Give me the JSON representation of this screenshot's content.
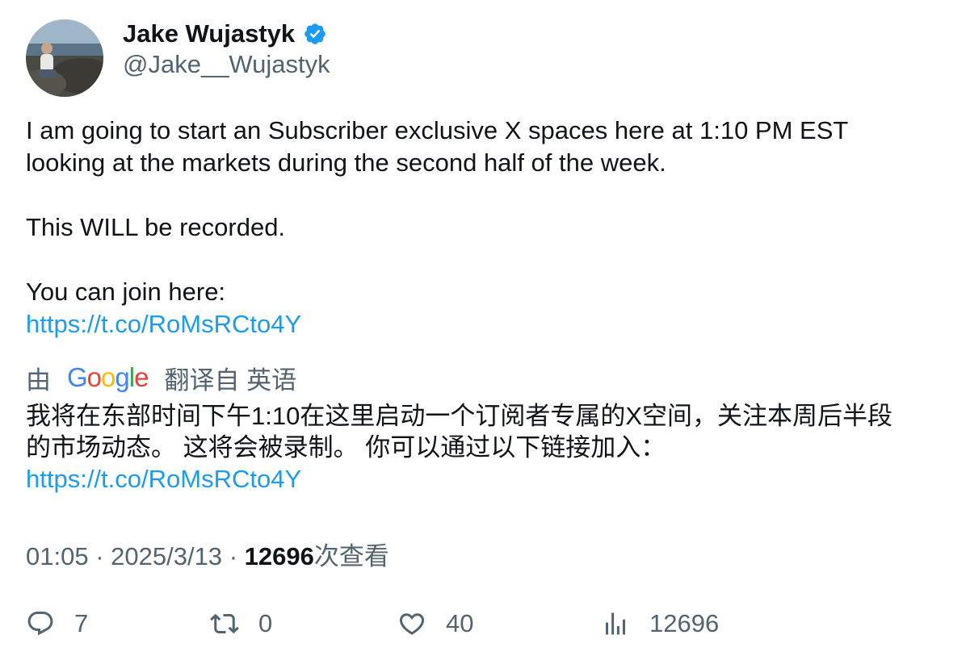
{
  "author": {
    "name": "Jake Wujastyk",
    "handle": "@Jake__Wujastyk",
    "verified": true
  },
  "tweet": {
    "line1": "I am going to start an Subscriber exclusive X spaces here at 1:10 PM EST",
    "line2": "looking at the markets during the second half of the week.",
    "line3": "This WILL be recorded.",
    "line4": "You can join here:",
    "link": "https://t.co/RoMsRCto4Y"
  },
  "translation": {
    "prefix": "由",
    "provider": "Google",
    "suffix": "翻译自 英语",
    "line1": "我将在东部时间下午1:10在这里启动一个订阅者专属的X空间，关注本周后半段",
    "line2": "的市场动态。 这将会被录制。 你可以通过以下链接加入：",
    "link": "https://t.co/RoMsRCto4Y"
  },
  "meta": {
    "time": "01:05",
    "date": "2025/3/13",
    "views": "12696",
    "views_label": "次查看"
  },
  "actions": {
    "replies": "7",
    "reposts": "0",
    "likes": "40",
    "views": "12696"
  },
  "colors": {
    "link": "#1d9bf0",
    "secondary_text": "#536471",
    "verified_badge": "#1d9bf0"
  }
}
